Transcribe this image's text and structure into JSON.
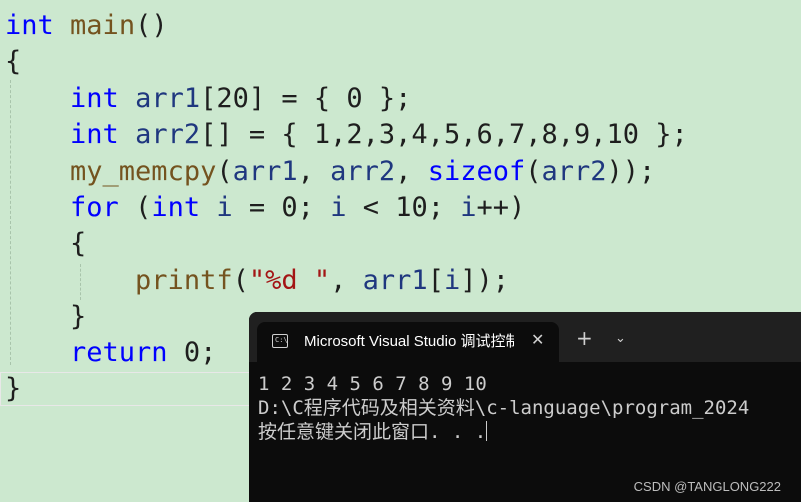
{
  "editor": {
    "lines": [
      [
        {
          "t": "int",
          "c": "kw"
        },
        {
          "t": " ",
          "c": ""
        },
        {
          "t": "main",
          "c": "fn"
        },
        {
          "t": "()",
          "c": ""
        }
      ],
      [
        {
          "t": "{",
          "c": ""
        }
      ],
      [
        {
          "t": "    ",
          "c": ""
        },
        {
          "t": "int",
          "c": "kw"
        },
        {
          "t": " ",
          "c": ""
        },
        {
          "t": "arr1",
          "c": "var"
        },
        {
          "t": "[20] = { 0 };",
          "c": ""
        }
      ],
      [
        {
          "t": "    ",
          "c": ""
        },
        {
          "t": "int",
          "c": "kw"
        },
        {
          "t": " ",
          "c": ""
        },
        {
          "t": "arr2",
          "c": "var"
        },
        {
          "t": "[] = { 1,2,3,4,5,6,7,8,9,10 };",
          "c": ""
        }
      ],
      [
        {
          "t": "    ",
          "c": ""
        },
        {
          "t": "my_memcpy",
          "c": "fn"
        },
        {
          "t": "(",
          "c": ""
        },
        {
          "t": "arr1",
          "c": "var"
        },
        {
          "t": ", ",
          "c": ""
        },
        {
          "t": "arr2",
          "c": "var"
        },
        {
          "t": ", ",
          "c": ""
        },
        {
          "t": "sizeof",
          "c": "kw"
        },
        {
          "t": "(",
          "c": ""
        },
        {
          "t": "arr2",
          "c": "var"
        },
        {
          "t": "));",
          "c": ""
        }
      ],
      [
        {
          "t": "    ",
          "c": ""
        },
        {
          "t": "for",
          "c": "kw"
        },
        {
          "t": " (",
          "c": ""
        },
        {
          "t": "int",
          "c": "kw"
        },
        {
          "t": " ",
          "c": ""
        },
        {
          "t": "i",
          "c": "var"
        },
        {
          "t": " = 0; ",
          "c": ""
        },
        {
          "t": "i",
          "c": "var"
        },
        {
          "t": " < 10; ",
          "c": ""
        },
        {
          "t": "i",
          "c": "var"
        },
        {
          "t": "++)",
          "c": ""
        }
      ],
      [
        {
          "t": "    {",
          "c": ""
        }
      ],
      [
        {
          "t": "        ",
          "c": ""
        },
        {
          "t": "printf",
          "c": "fn"
        },
        {
          "t": "(",
          "c": ""
        },
        {
          "t": "\"%d \"",
          "c": "str"
        },
        {
          "t": ", ",
          "c": ""
        },
        {
          "t": "arr1",
          "c": "var"
        },
        {
          "t": "[",
          "c": ""
        },
        {
          "t": "i",
          "c": "var"
        },
        {
          "t": "]);",
          "c": ""
        }
      ],
      [
        {
          "t": "    }",
          "c": ""
        }
      ],
      [
        {
          "t": "    ",
          "c": ""
        },
        {
          "t": "return",
          "c": "kw"
        },
        {
          "t": " 0;",
          "c": ""
        }
      ],
      [
        {
          "t": "}",
          "c": ""
        }
      ]
    ]
  },
  "terminal": {
    "tab_title": "Microsoft Visual Studio 调试控制台",
    "tab_icon_glyph": "C:\\",
    "close_glyph": "✕",
    "new_tab_glyph": "+",
    "dropdown_glyph": "⌄",
    "output": [
      "1 2 3 4 5 6 7 8 9 10",
      "D:\\C程序代码及相关资料\\c-language\\program_2024",
      "按任意键关闭此窗口. . ."
    ]
  },
  "watermark": "CSDN @TANGLONG222",
  "colors": {
    "editor_bg": "#cce8cf",
    "keyword": "#0000ff",
    "function": "#74531f",
    "variable": "#1f377f",
    "string": "#a31515",
    "terminal_bg": "#0c0c0c"
  }
}
